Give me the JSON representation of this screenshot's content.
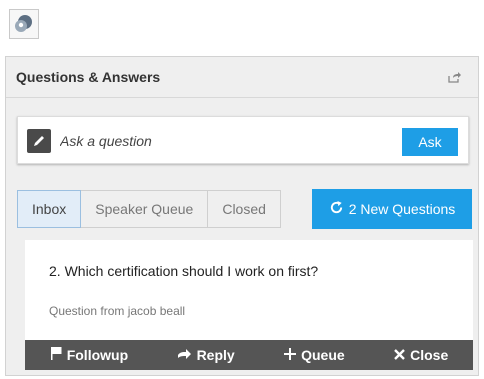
{
  "app": {
    "icon": "support-bubble-icon"
  },
  "panel": {
    "title": "Questions & Answers",
    "popout_icon": "popout-icon"
  },
  "ask": {
    "placeholder": "Ask a question",
    "button": "Ask",
    "icon": "pencil-icon"
  },
  "tabs": [
    {
      "label": "Inbox",
      "active": true
    },
    {
      "label": "Speaker Queue",
      "active": false
    },
    {
      "label": "Closed",
      "active": false
    }
  ],
  "new_questions": {
    "label": "2 New Questions",
    "icon": "refresh-icon"
  },
  "question": {
    "text": "2. Which certification should I work on first?",
    "meta": "Question from jacob beall"
  },
  "actions": [
    {
      "label": "Followup",
      "icon": "flag-icon"
    },
    {
      "label": "Reply",
      "icon": "arrow-right-icon"
    },
    {
      "label": "Queue",
      "icon": "plus-icon"
    },
    {
      "label": "Close",
      "icon": "close-icon"
    }
  ],
  "colors": {
    "accent": "#1e9ee6",
    "action_bar": "#555555",
    "panel_bg": "#efefef"
  }
}
